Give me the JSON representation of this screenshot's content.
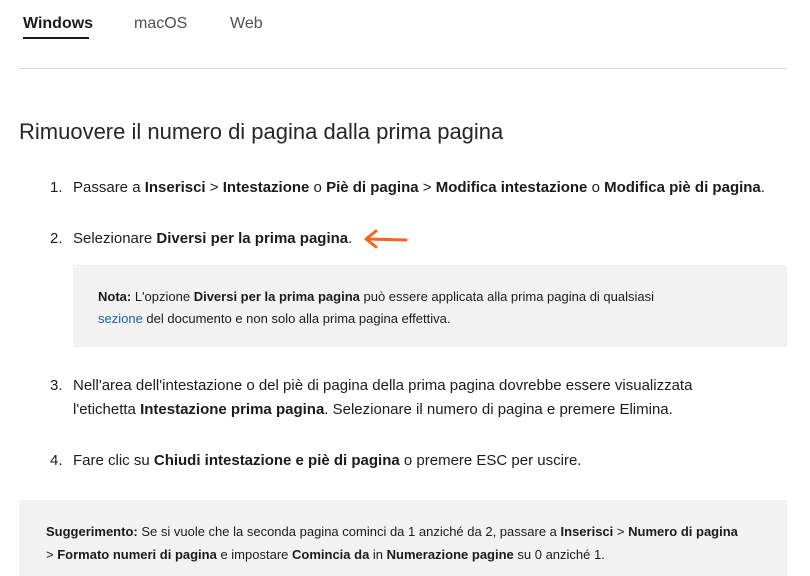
{
  "tabs": [
    {
      "label": "Windows",
      "active": true
    },
    {
      "label": "macOS",
      "active": false
    },
    {
      "label": "Web",
      "active": false
    }
  ],
  "title": "Rimuovere il numero di pagina dalla prima pagina",
  "steps": [
    {
      "num": "1.",
      "parts": [
        "Passare a ",
        "Inserisci",
        " > ",
        "Intestazione",
        " o ",
        "Piè di pagina",
        " > ",
        "Modifica intestazione",
        " o ",
        "Modifica piè di pagina",
        "."
      ]
    },
    {
      "num": "2.",
      "parts": [
        "Selezionare ",
        "Diversi per la prima pagina",
        "."
      ]
    },
    {
      "num": "3.",
      "line1": "Nell'area dell'intestazione o del piè di pagina della prima pagina dovrebbe essere visualizzata",
      "parts2": [
        "l'etichetta ",
        "Intestazione prima pagina",
        ". Selezionare il numero di pagina e premere Elimina."
      ]
    },
    {
      "num": "4.",
      "parts": [
        "Fare clic su ",
        "Chiudi intestazione e piè di pagina",
        " o premere ESC per uscire."
      ]
    }
  ],
  "note": {
    "label": "Nota:",
    "t1": " L'opzione ",
    "b1": "Diversi per la prima pagina",
    "t2": " può essere applicata alla prima pagina di qualsiasi",
    "link": "sezione",
    "t3": " del documento e non solo alla prima pagina effettiva."
  },
  "tip": {
    "label": "Suggerimento:",
    "parts": [
      " Se si vuole che la seconda pagina cominci da 1 anziché da 2, passare a ",
      "Inserisci",
      " > ",
      "Numero di pagina",
      " > ",
      "Formato numeri di pagina",
      " e impostare ",
      "Comincia da",
      " in ",
      "Numerazione pagine",
      " su 0 anziché 1."
    ]
  },
  "colors": {
    "accent_arrow": "#f26522",
    "link": "#1862a8",
    "box_bg": "#f2f2f2"
  },
  "icons": {
    "annotation": "arrow-left-icon"
  }
}
